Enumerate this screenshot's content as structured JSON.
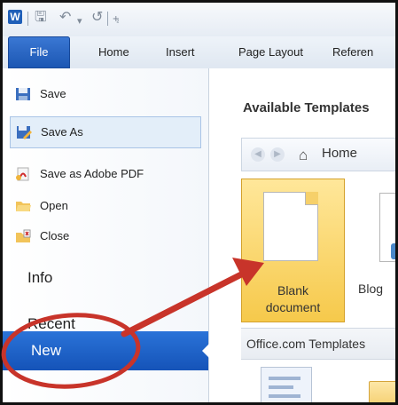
{
  "qat": {
    "app_icon": "W",
    "icons": [
      "save-icon",
      "undo-icon",
      "dropdown-caret-icon",
      "redo-icon",
      "customize-qat-icon"
    ]
  },
  "ribbon": {
    "tabs": [
      "File",
      "Home",
      "Insert",
      "Page Layout",
      "Referen"
    ]
  },
  "backstage": {
    "items": [
      {
        "label": "Save",
        "icon": "save-icon"
      },
      {
        "label": "Save As",
        "icon": "save-as-icon"
      },
      {
        "label": "Save as Adobe PDF",
        "icon": "pdf-icon"
      },
      {
        "label": "Open",
        "icon": "open-folder-icon"
      },
      {
        "label": "Close",
        "icon": "close-doc-icon"
      }
    ],
    "info": "Info",
    "recent": "Recent",
    "new": "New"
  },
  "templates": {
    "heading": "Available Templates",
    "nav_home": "Home",
    "blank_label_line1": "Blank",
    "blank_label_line2": "document",
    "blog_label": "Blog",
    "office_com": "Office.com Templates"
  },
  "colors": {
    "accent": "#1b56b2",
    "annotation": "#c8342a",
    "tile_selected": "#f6c94b"
  }
}
